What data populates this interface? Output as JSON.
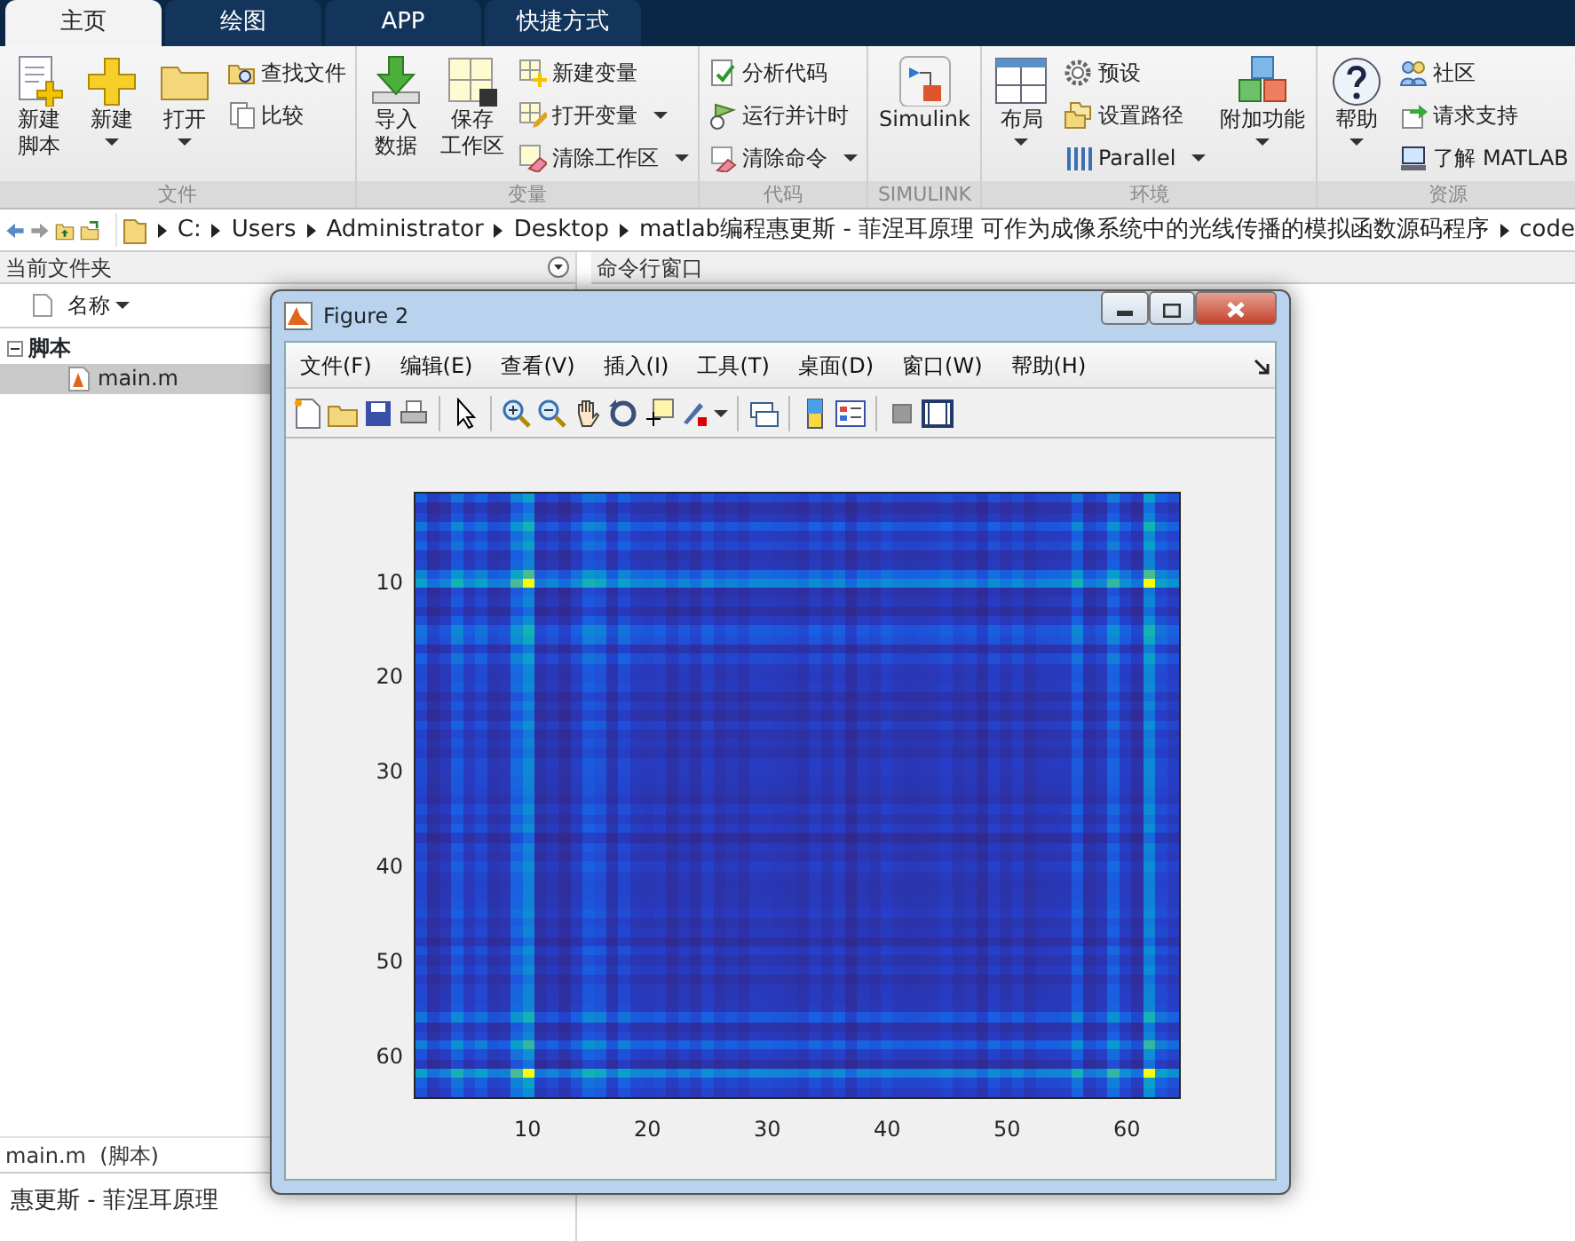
{
  "tabs": [
    {
      "label": "主页",
      "selected": true
    },
    {
      "label": "绘图",
      "selected": false
    },
    {
      "label": "APP",
      "selected": false
    },
    {
      "label": "快捷方式",
      "selected": false
    }
  ],
  "toolstrip": [
    {
      "label": "文件",
      "items": [
        {
          "kind": "large",
          "lines": [
            "新建",
            "脚本"
          ],
          "dropdown": false
        },
        {
          "kind": "large",
          "lines": [
            "新建"
          ],
          "dropdown": true
        },
        {
          "kind": "large",
          "lines": [
            "打开"
          ],
          "dropdown": true
        },
        {
          "kind": "stack",
          "entries": [
            {
              "label": "查找文件",
              "dropdown": false
            },
            {
              "label": "比较",
              "dropdown": false
            }
          ]
        }
      ]
    },
    {
      "label": "变量",
      "items": [
        {
          "kind": "large",
          "lines": [
            "导入",
            "数据"
          ],
          "dropdown": false
        },
        {
          "kind": "large",
          "lines": [
            "保存",
            "工作区"
          ],
          "dropdown": false
        },
        {
          "kind": "stack",
          "entries": [
            {
              "label": "新建变量",
              "dropdown": false
            },
            {
              "label": "打开变量",
              "dropdown": true
            },
            {
              "label": "清除工作区",
              "dropdown": true
            }
          ]
        }
      ]
    },
    {
      "label": "代码",
      "items": [
        {
          "kind": "stack",
          "entries": [
            {
              "label": "分析代码",
              "dropdown": false
            },
            {
              "label": "运行并计时",
              "dropdown": false
            },
            {
              "label": "清除命令",
              "dropdown": true
            }
          ]
        }
      ]
    },
    {
      "label": "SIMULINK",
      "items": [
        {
          "kind": "large",
          "lines": [
            "Simulink"
          ],
          "dropdown": false
        }
      ]
    },
    {
      "label": "环境",
      "items": [
        {
          "kind": "large",
          "lines": [
            "布局"
          ],
          "dropdown": true
        },
        {
          "kind": "stack",
          "entries": [
            {
              "label": "预设",
              "dropdown": false
            },
            {
              "label": "设置路径",
              "dropdown": false
            },
            {
              "label": "Parallel",
              "dropdown": true
            }
          ]
        },
        {
          "kind": "large",
          "lines": [
            "附加功能"
          ],
          "dropdown": true
        }
      ]
    },
    {
      "label": "资源",
      "items": [
        {
          "kind": "large",
          "lines": [
            "帮助"
          ],
          "dropdown": true
        },
        {
          "kind": "stack",
          "entries": [
            {
              "label": "社区",
              "dropdown": false
            },
            {
              "label": "请求支持",
              "dropdown": false
            },
            {
              "label": "了解 MATLAB",
              "dropdown": false
            }
          ]
        }
      ]
    }
  ],
  "address_bar": {
    "crumbs": [
      "C:",
      "Users",
      "Administrator",
      "Desktop",
      "matlab编程惠更斯 - 菲涅耳原理 可作为成像系统中的光线传播的模拟函数源码程序",
      "code"
    ]
  },
  "current_folder": {
    "title": "当前文件夹",
    "column": "名称",
    "tree": [
      {
        "label": "脚本",
        "expanded": true,
        "children": [
          {
            "label": "main.m",
            "selected": true
          }
        ]
      }
    ],
    "details": {
      "file": "main.m  (脚本)",
      "title": "惠更斯 - 菲涅耳原理"
    }
  },
  "command_window": {
    "title": "命令行窗口"
  },
  "figure": {
    "title": "Figure 2",
    "menu": [
      "文件(F)",
      "编辑(E)",
      "查看(V)",
      "插入(I)",
      "工具(T)",
      "桌面(D)",
      "窗口(W)",
      "帮助(H)"
    ],
    "axes": {
      "yticks": [
        "10",
        "20",
        "30",
        "40",
        "50",
        "60"
      ],
      "xticks": [
        "10",
        "20",
        "30",
        "40",
        "50",
        "60"
      ]
    }
  }
}
